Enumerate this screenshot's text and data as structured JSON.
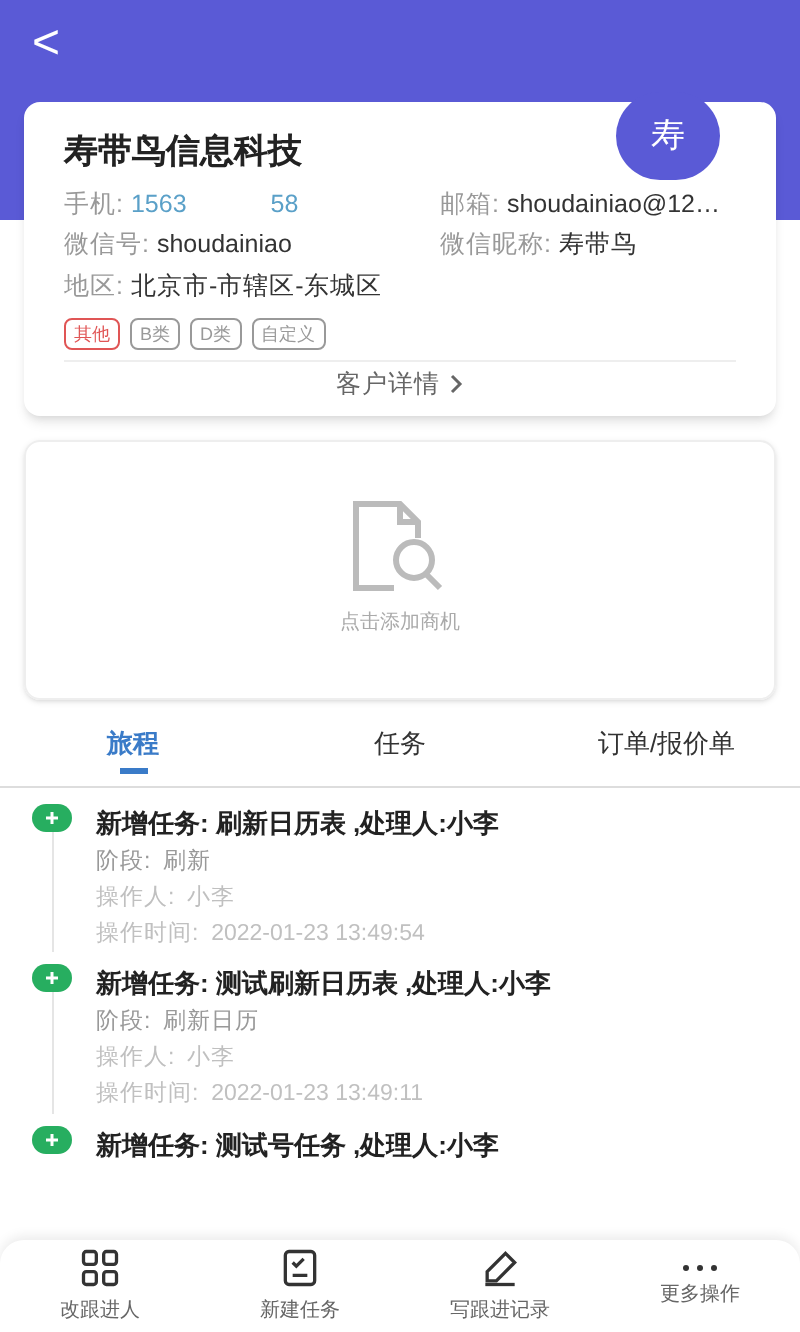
{
  "header": {
    "back": "<"
  },
  "customer": {
    "name": "寿带鸟信息科技",
    "avatar": "寿",
    "fields": [
      {
        "label": "手机:",
        "value": "1563",
        "value_tail": "58",
        "kind": "phone"
      },
      {
        "label": "邮箱:",
        "value": "shoudainiao@12…",
        "kind": "text"
      },
      {
        "label": "微信号:",
        "value": "shoudainiao",
        "kind": "text"
      },
      {
        "label": "微信昵称:",
        "value": "寿带鸟",
        "kind": "text"
      },
      {
        "label": "地区:",
        "value": "北京市-市辖区-东城区",
        "kind": "text"
      }
    ],
    "tags": [
      {
        "label": "其他",
        "color": "#e05555"
      },
      {
        "label": "B类",
        "color": "#999999"
      },
      {
        "label": "D类",
        "color": "#999999"
      },
      {
        "label": "自定义",
        "color": "#999999"
      }
    ],
    "detail_link": "客户详情"
  },
  "opportunity": {
    "hint": "点击添加商机"
  },
  "tabs": [
    {
      "label": "旅程",
      "selected": true
    },
    {
      "label": "任务",
      "selected": false
    },
    {
      "label": "订单/报价单",
      "selected": false
    }
  ],
  "timeline": [
    {
      "title": "新增任务: 刷新日历表 ,处理人:小李",
      "lines": [
        "阶段:  刷新",
        "操作人:  小李",
        "操作时间:  2022-01-23 13:49:54"
      ]
    },
    {
      "title": "新增任务: 测试刷新日历表 ,处理人:小李",
      "lines": [
        "阶段:  刷新日历",
        "操作人:  小李",
        "操作时间:  2022-01-23 13:49:11"
      ]
    },
    {
      "title": "新增任务: 测试号任务 ,处理人:小李"
    }
  ],
  "bottom_nav": [
    {
      "label": "改跟进人",
      "kind": "grid"
    },
    {
      "label": "新建任务",
      "kind": "task"
    },
    {
      "label": "写跟进记录",
      "kind": "pen"
    },
    {
      "label": "更多操作",
      "kind": "more"
    }
  ]
}
